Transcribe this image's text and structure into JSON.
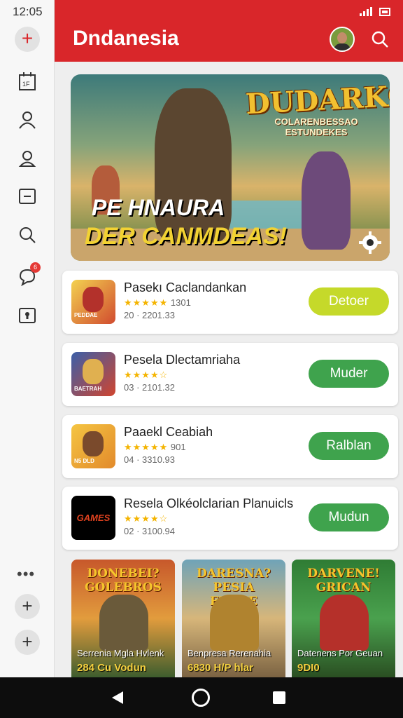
{
  "status_bar": {
    "time": "12:05"
  },
  "header": {
    "title": "Dndanesia"
  },
  "sidebar": {
    "badge_count": "6",
    "more": "•••"
  },
  "banner": {
    "title": "DUDARKG",
    "subtitle_line1": "COLARENBESSAO",
    "subtitle_line2": "ESTUNDEKES",
    "tagline_line1": "PE HNAURA",
    "tagline_line2": "DER CANMDEAS!"
  },
  "apps": [
    {
      "name": "Pasekı Caclandankan",
      "rating_stars": "★★★★★",
      "rating_text": "1301",
      "meta": "20 · 2201.33",
      "button": "Detoer",
      "button_color": "#c5d92a",
      "icon_label": "PEDDAE"
    },
    {
      "name": "Pesela Dlectamriaha",
      "rating_stars": "★★★★☆",
      "rating_text": "",
      "meta": "03 · 2101.32",
      "button": "Muder",
      "button_color": "#3fa34d",
      "icon_label": "BAETRAH"
    },
    {
      "name": "Paaekl Ceabiah",
      "rating_stars": "★★★★★",
      "rating_text": "901",
      "meta": "04 · 3310.93",
      "button": "Ralblan",
      "button_color": "#3fa34d",
      "icon_label": "N5 DLD"
    },
    {
      "name": "Resela Olkéolclarian Planuicls",
      "rating_stars": "★★★★☆",
      "rating_text": "",
      "meta": "02 · 3100.94",
      "button": "Mudun",
      "button_color": "#3fa34d",
      "icon_label": "GAMES"
    }
  ],
  "tiles": [
    {
      "title": "DONEBEI? GOLEBROS",
      "name": "Serrenia Mgla Hvlenk",
      "tag": "284 Cu Vodun"
    },
    {
      "title": "DARESNA? PESIA FRANE",
      "name": "Benpresa Rerenahia",
      "tag": "6830 H/P hlar"
    },
    {
      "title": "DARVENE! GRICAN",
      "name": "Datenens Por Geuan",
      "tag": "9DI0"
    }
  ],
  "colors": {
    "brand_red": "#d9262a",
    "green": "#3fa34d",
    "lime": "#c5d92a",
    "nav_dark": "#0d0d0d"
  }
}
